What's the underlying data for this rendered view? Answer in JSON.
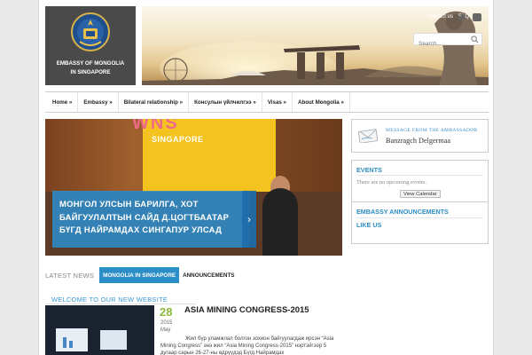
{
  "logo": {
    "line1": "EMBASSY OF MONGOLIA",
    "line2": "IN SINGAPORE"
  },
  "top_links": [
    "Contact us",
    "FAQ"
  ],
  "search": {
    "placeholder": "Search..."
  },
  "nav": [
    "Home »",
    "Embassy »",
    "Bilateral relationship »",
    "Консулын үйлчилгээ »",
    "Visas »",
    "About Mongolia »"
  ],
  "slider": {
    "sign_top": "WNS",
    "sign": "SINGAPORE",
    "caption": "МОНГОЛ УЛСЫН БАРИЛГА, ХОТ БАЙГУУЛАЛТЫН САЙД Д.ЦОГТБААТАР БҮГД НАЙРАМДАХ СИНГАПУР УЛСАД",
    "arrow": "›"
  },
  "tabs": {
    "latest": "LATEST NEWS",
    "items": [
      "MONGOLIA IN SINGAPORE",
      "ANNOUNCEMENTS"
    ]
  },
  "welcome": "WELCOME TO OUR NEW WEBSITE",
  "news": {
    "day": "28",
    "year": "2015",
    "month": "May",
    "title": "ASIA MINING CONGRESS-2015",
    "text": "Жил бүр уламжлал болгон зохион байгуулагдаж ирсэн “Asia Mining Congress” энэ жил “Asia Mining Congress-2015” нэртэйгээр 5 дугаар сарын 26-27-ны өдрүүдэд Бүгд Найрамдах"
  },
  "sidebar": {
    "ambassador_title": "MESSAGE FROM THE AMBASSADOR",
    "ambassador_name": "Banzragch Delgermaa",
    "events_title": "EVENTS",
    "events_empty": "There are no upcoming events.",
    "view_calendar": "View Calendar",
    "announcements_title": "EMBASSY ANNOUNCEMENTS",
    "like_us": "LIKE US"
  },
  "colors": {
    "accent": "#2c8ec6",
    "date_green": "#8ab83a",
    "logo_bg": "#4a4a4a"
  }
}
